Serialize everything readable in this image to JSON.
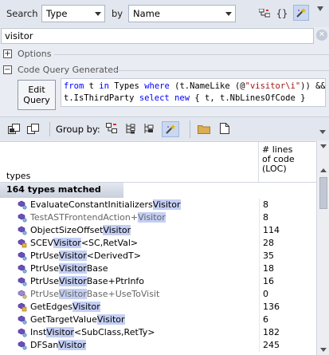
{
  "search": {
    "label": "Search",
    "type_value": "Type",
    "by_label": "by",
    "field_value": "Name",
    "input_value": "visitor"
  },
  "sections": {
    "options": "Options",
    "generated": "Code Query Generated"
  },
  "edit_button": {
    "line1": "Edit",
    "line2": "Query"
  },
  "query": {
    "line1_parts": [
      "from",
      " t ",
      "in",
      " Types ",
      "where",
      " (t.NameLike (@",
      "\"visitor\\i\"",
      ")) && !"
    ],
    "line2_parts": [
      "t.IsThirdParty ",
      "select",
      " ",
      "new",
      " { t, t.NbLinesOfCode }"
    ]
  },
  "toolbar2": {
    "group_by": "Group by:"
  },
  "grid": {
    "col_types": "types",
    "col_loc": [
      "# lines",
      "of code",
      "(LOC)"
    ],
    "group_label": "164 types matched",
    "rows": [
      {
        "pre": "EvaluateConstantInitializers",
        "hl": "Visitor",
        "post": "",
        "loc": "8",
        "dim": false,
        "icon": "class-icon"
      },
      {
        "pre": "TestASTFrontendAction+",
        "hl": "Visitor",
        "post": "",
        "loc": "8",
        "dim": true,
        "icon": "class-icon"
      },
      {
        "pre": "ObjectSizeOffset",
        "hl": "Visitor",
        "post": "",
        "loc": "114",
        "dim": false,
        "icon": "class-icon"
      },
      {
        "pre": "SCEV",
        "hl": "Visitor",
        "post": "<SC,RetVal>",
        "loc": "28",
        "dim": false,
        "icon": "template-icon"
      },
      {
        "pre": "PtrUse",
        "hl": "Visitor",
        "post": "<DerivedT>",
        "loc": "35",
        "dim": false,
        "icon": "class-icon"
      },
      {
        "pre": "PtrUse",
        "hl": "Visitor",
        "post": "Base",
        "loc": "18",
        "dim": false,
        "icon": "class-icon"
      },
      {
        "pre": "PtrUse",
        "hl": "Visitor",
        "post": "Base+PtrInfo",
        "loc": "16",
        "dim": false,
        "icon": "class-icon"
      },
      {
        "pre": "PtrUse",
        "hl": "Visitor",
        "post": "Base+UseToVisit",
        "loc": "0",
        "dim": true,
        "icon": "struct-icon"
      },
      {
        "pre": "GetEdges",
        "hl": "Visitor",
        "post": "",
        "loc": "136",
        "dim": false,
        "icon": "template-icon"
      },
      {
        "pre": "GetTargetValue",
        "hl": "Visitor",
        "post": "",
        "loc": "6",
        "dim": false,
        "icon": "class-icon"
      },
      {
        "pre": "Inst",
        "hl": "Visitor",
        "post": "<SubClass,RetTy>",
        "loc": "182",
        "dim": false,
        "icon": "class-icon"
      },
      {
        "pre": "DFSan",
        "hl": "Visitor",
        "post": "",
        "loc": "245",
        "dim": false,
        "icon": "class-icon"
      }
    ]
  },
  "colors": {
    "highlight": "#c4cff4",
    "keyword": "#0000ff",
    "string": "#a31515"
  }
}
